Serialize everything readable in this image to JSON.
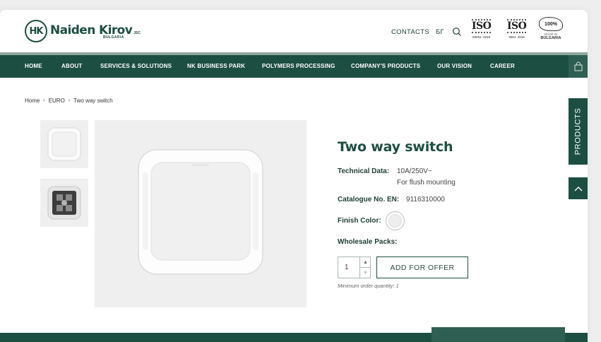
{
  "header": {
    "logo": {
      "mark": "HK",
      "name": "Naiden Kirov",
      "suffix": "JSC",
      "country": "BULGARIA"
    },
    "links": {
      "contacts": "CONTACTS",
      "lang": "БГ"
    },
    "certs": [
      {
        "badge": "ISO",
        "sub": "50001: 2018"
      },
      {
        "badge": "ISO",
        "sub": "9001: 2015"
      }
    ],
    "made": {
      "percent": "100%",
      "line": "MADE IN",
      "country": "BULGARIA"
    }
  },
  "nav": {
    "items": [
      "HOME",
      "ABOUT",
      "SERVICES & SOLUTIONS",
      "NK BUSINESS PARK",
      "POLYMERS PROCESSING",
      "COMPANY'S PRODUCTS",
      "OUR VISION",
      "CAREER"
    ]
  },
  "breadcrumb": {
    "items": [
      "Home",
      "EURO",
      "Two way switch"
    ]
  },
  "product": {
    "title": "Two way switch",
    "tech_label": "Technical Data:",
    "tech_value_1": "10A/250V~",
    "tech_value_2": "For flush mounting",
    "catalogue_label": "Catalogue No. EN:",
    "catalogue_value": "9116310000",
    "finish_label": "Finish Color:",
    "finish_color": "#eeeeee",
    "wholesale_label": "Wholesale Packs:",
    "quantity": "1",
    "add_button": "ADD FOR OFFER",
    "min_order": "Minimum order quantity: 1"
  },
  "side": {
    "products_tab": "PRODUCTS"
  },
  "colors": {
    "primary": "#1d4e42",
    "accent": "#2f5f53",
    "line": "#8fa9a1"
  }
}
